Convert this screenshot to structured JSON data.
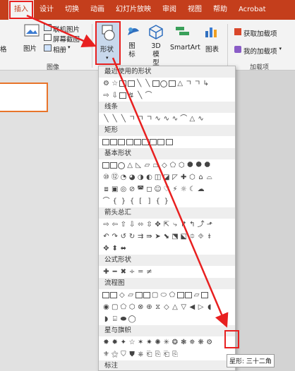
{
  "tabs": [
    "插入",
    "设计",
    "切换",
    "动画",
    "幻灯片放映",
    "审阅",
    "视图",
    "帮助",
    "Acrobat"
  ],
  "ribbon": {
    "left_cut": "格",
    "picture": "图片",
    "online_picture": "联机图片",
    "screenshot": "屏幕截图",
    "album": "相册",
    "image_group": "图像",
    "shapes": "形状",
    "icons": "图标",
    "model_3d": "3D 模型",
    "smartart": "SmartArt",
    "chart": "图表",
    "get_addins": "获取加载项",
    "my_addins": "我的加载项",
    "addins_group": "加载项"
  },
  "gallery": {
    "categories": [
      "最近使用的形状",
      "线条",
      "矩形",
      "基本形状",
      "箭头总汇",
      "公式形状",
      "流程图",
      "星与旗帜",
      "标注"
    ]
  },
  "tooltip": "星形: 三十二角",
  "colors": {
    "ribbon_red": "#c43e1c",
    "highlight_red": "#e82020"
  }
}
